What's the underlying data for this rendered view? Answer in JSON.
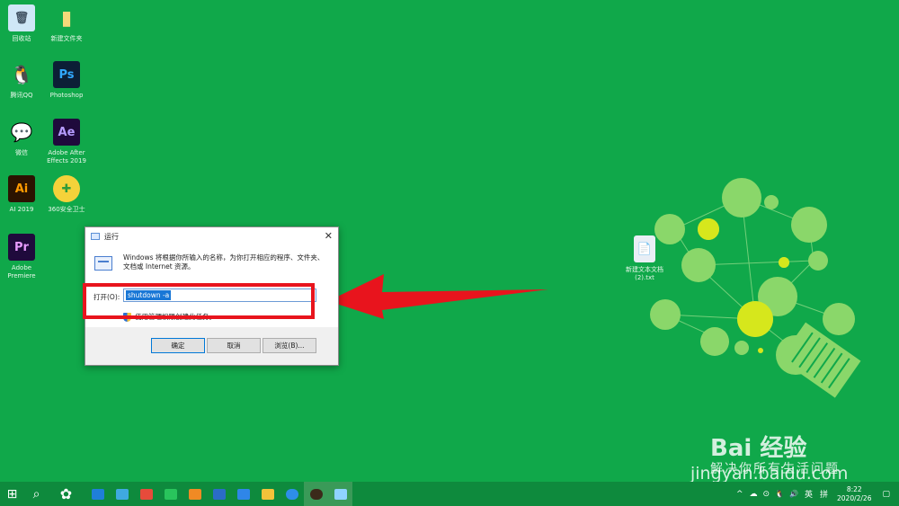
{
  "desktop": {
    "icons": [
      {
        "label": "回收站",
        "glyph": "🗑",
        "bg": "#cfe7f7",
        "fg": "#456"
      },
      {
        "label": "新建文件夹",
        "glyph": "▮",
        "bg": "#10a84a",
        "fg": "#f5d97a"
      },
      {
        "label": "腾讯QQ",
        "glyph": "🐧",
        "bg": "#10a84a",
        "fg": "#111"
      },
      {
        "label": "Photoshop",
        "glyph": "Ps",
        "bg": "#0c1f36",
        "fg": "#31a8ff"
      },
      {
        "label": "微信",
        "glyph": "💬",
        "bg": "#10a84a",
        "fg": "#fff"
      },
      {
        "label": "Adobe After Effects 2019",
        "glyph": "Ae",
        "bg": "#1f0a3c",
        "fg": "#b69cff"
      },
      {
        "label": "AI 2019",
        "glyph": "Ai",
        "bg": "#2b1300",
        "fg": "#ff9a00"
      },
      {
        "label": "360安全卫士",
        "glyph": "✚",
        "bg": "#f4d23a",
        "fg": "#2f9b3a"
      },
      {
        "label": "Adobe Premiere",
        "glyph": "Pr",
        "bg": "#1f0a3c",
        "fg": "#e89bff"
      },
      {
        "label": "新建文本文档 (2).txt",
        "glyph": "📄",
        "bg": "#e8eef5",
        "fg": "#345"
      }
    ]
  },
  "run_dialog": {
    "title": "运行",
    "close": "✕",
    "description": "Windows 将根据你所输入的名称，为你打开相应的程序、文件夹、文档或 Internet 资源。",
    "open_label": "打开(O):",
    "input_value": "shutdown -a",
    "admin_note": "使用管理权限创建此任务。",
    "buttons": {
      "ok": "确定",
      "cancel": "取消",
      "browse": "浏览(B)..."
    }
  },
  "annotation": {
    "color": "#e8141d"
  },
  "taskbar": {
    "start": "⊞",
    "search": "⌕",
    "apps": [
      {
        "name": "fan-icon",
        "glyph": "✿",
        "bg": "transparent"
      },
      {
        "name": "edge-icon",
        "glyph": "e",
        "bg": "#1f7fd8"
      },
      {
        "name": "net-icon",
        "glyph": "◆",
        "bg": "#3fa9e0"
      },
      {
        "name": "store-icon",
        "glyph": "▤",
        "bg": "#e64b3b"
      },
      {
        "name": "wechat-icon",
        "glyph": "●",
        "bg": "#29c45c"
      },
      {
        "name": "photo-icon",
        "glyph": "▣",
        "bg": "#f08a24"
      },
      {
        "name": "docs-icon",
        "glyph": "W",
        "bg": "#2b6cc7"
      },
      {
        "name": "mail-icon",
        "glyph": "✉",
        "bg": "#2f86e8"
      },
      {
        "name": "folder-icon",
        "glyph": "▭",
        "bg": "#f3c23a"
      },
      {
        "name": "browser-icon",
        "glyph": "◉",
        "bg": "#2e8ee8"
      },
      {
        "name": "camera-icon",
        "glyph": "◎",
        "bg": "#3b2a1a"
      },
      {
        "name": "run-icon",
        "glyph": "▰",
        "bg": "#8fd3ff"
      }
    ],
    "tray": {
      "caret": "^",
      "cloud": "☁",
      "network": "⊙",
      "qq": "🐧",
      "volume": "🔊",
      "ime": "英",
      "ime_mode": "拼",
      "time": "8:22",
      "date": "2020/2/26",
      "notification": "▢"
    }
  },
  "watermark": {
    "logo": "Bai 经验",
    "slogan": "解决你所有生活问题",
    "url": "jingyan.baidu.com"
  }
}
